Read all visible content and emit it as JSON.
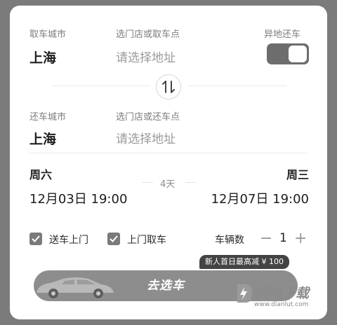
{
  "pickup": {
    "city_label": "取车城市",
    "city": "上海",
    "store_label": "选门店或取车点",
    "store_placeholder": "请选择地址",
    "diff_return_label": "异地还车"
  },
  "dropoff": {
    "city_label": "还车城市",
    "city": "上海",
    "store_label": "选门店或还车点",
    "store_placeholder": "请选择地址"
  },
  "dates": {
    "start_weekday": "周六",
    "start_datetime": "12月03日 19:00",
    "duration": "4天",
    "end_weekday": "周三",
    "end_datetime": "12月07日 19:00"
  },
  "options": {
    "delivery_label": "送车上门",
    "pickup_door_label": "上门取车",
    "vehicle_count_label": "车辆数",
    "minus": "−",
    "vehicle_count": "1",
    "plus": "+"
  },
  "promo": {
    "text": "新人首日最高减 ¥ 100"
  },
  "cta": {
    "label": "去选车"
  },
  "watermark": {
    "name": "闪电下载",
    "url": "www.dianlut.com"
  },
  "colors": {
    "toggle_on": "#6d6d6d",
    "checkbox": "#7a7a7a",
    "cta_bg": "#8d8d8d",
    "promo_bg": "#444444"
  }
}
